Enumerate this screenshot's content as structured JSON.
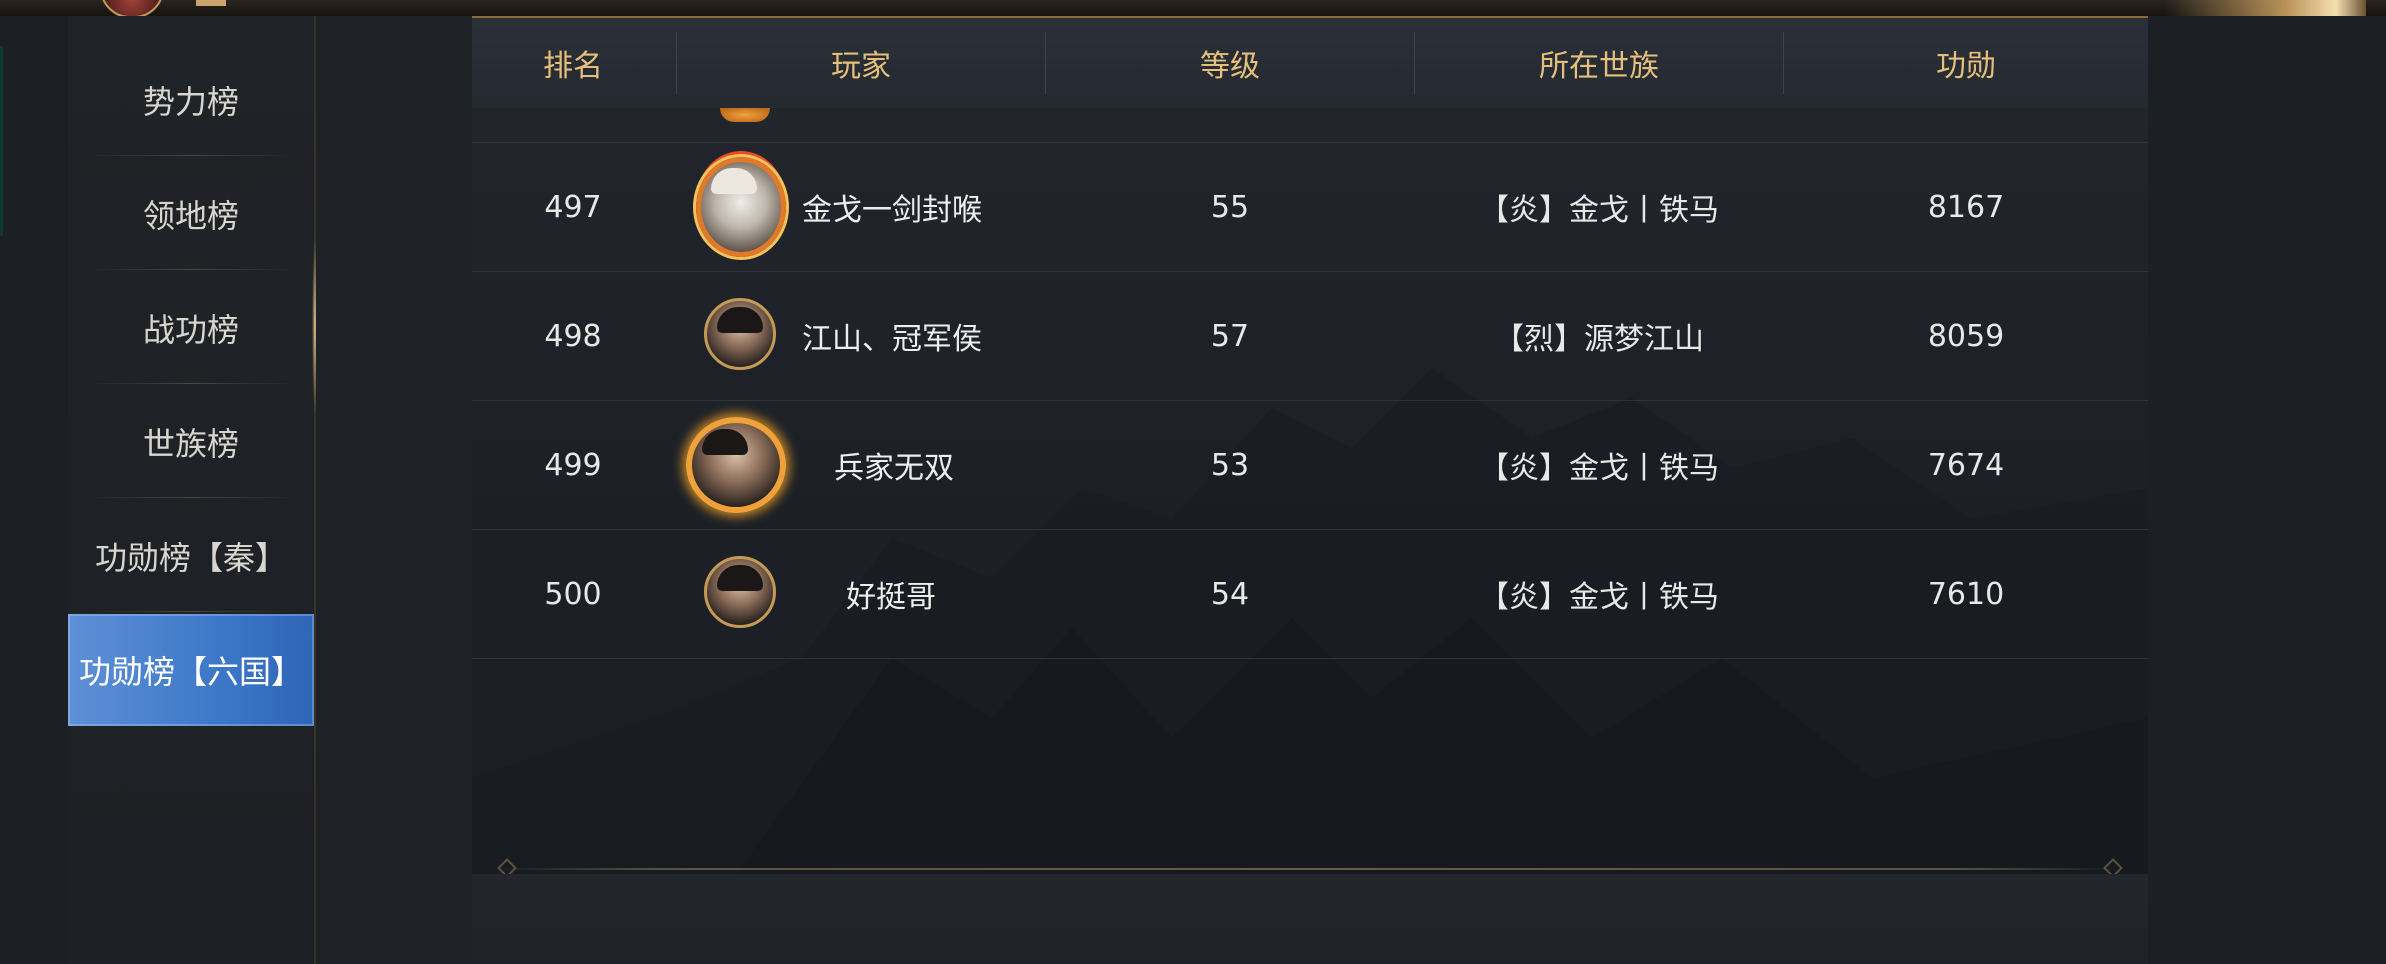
{
  "sidebar": {
    "items": [
      {
        "label": "势力榜",
        "active": false
      },
      {
        "label": "领地榜",
        "active": false
      },
      {
        "label": "战功榜",
        "active": false
      },
      {
        "label": "世族榜",
        "active": false
      },
      {
        "label": "功勋榜【秦】",
        "active": false
      },
      {
        "label": "功勋榜【六国】",
        "active": true
      }
    ]
  },
  "table": {
    "headers": [
      "排名",
      "玩家",
      "等级",
      "所在世族",
      "功勋"
    ],
    "rows": [
      {
        "rank": "497",
        "player": "金戈一剑封喉",
        "level": "55",
        "clan": "【炎】金戈丨铁马",
        "merit": "8167",
        "avatar": "elder-portrait-icon"
      },
      {
        "rank": "498",
        "player": "江山、冠军侯",
        "level": "57",
        "clan": "【烈】源梦江山",
        "merit": "8059",
        "avatar": "warrior-portrait-icon"
      },
      {
        "rank": "499",
        "player": "兵家无双",
        "level": "53",
        "clan": "【炎】金戈丨铁马",
        "merit": "7674",
        "avatar": "flame-portrait-icon"
      },
      {
        "rank": "500",
        "player": "好挺哥",
        "level": "54",
        "clan": "【炎】金戈丨铁马",
        "merit": "7610",
        "avatar": "warrior-portrait-icon"
      }
    ]
  },
  "colors": {
    "header_text": "#e6c07a",
    "active_tab": "#3d78c8",
    "row_text": "#e8e8e8"
  }
}
